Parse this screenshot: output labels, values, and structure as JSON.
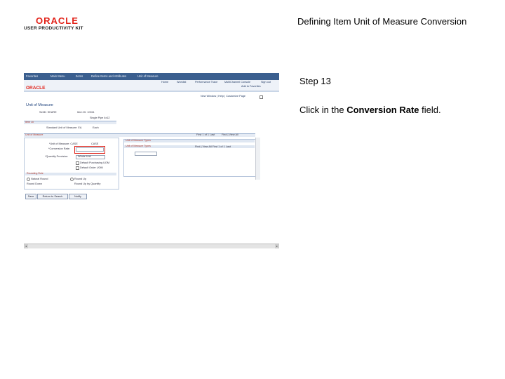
{
  "header": {
    "brand": "ORACLE",
    "product": "USER PRODUCTIVITY KIT",
    "title": "Defining Item Unit of Measure Conversion"
  },
  "step": {
    "label": "Step 13",
    "instruction_prefix": "Click in the ",
    "instruction_field": "Conversion Rate",
    "instruction_suffix": " field."
  },
  "screenshot": {
    "nav_links": [
      "Favorites",
      "Main Menu",
      "Items",
      "Define Items and Attributes",
      "Unit of Measure"
    ],
    "brand": "ORACLE",
    "menu_tabs": [
      "Home",
      "Worklist",
      "Performance Trace",
      "MultiChannel Console",
      "Add to Favorites",
      "Sign out"
    ],
    "page_links": [
      "New Window",
      "Help",
      "Customize Page"
    ],
    "page_title": "Unit of Measure",
    "fields": {
      "setid_label": "SetID: SHARE",
      "item_id_label": "Item ID: 10011",
      "item_desc": "Single Pipe 4x12",
      "item_section": "Item 10",
      "std_uom_label": "Standard Unit of Measure: EA",
      "each_label": "Each",
      "uom_section": "Unit of Measure",
      "unit_of_measure_label": "*Unit of Measure: CASE",
      "unit_of_measure_value": "CASE",
      "conversion_rate_label": "*Conversion Rate:",
      "conversion_rate_value": "",
      "quantity_precision_label": "*Quantity Precision:",
      "quantity_precision_value": "Whole Unit",
      "default_purchasing_label": "Default Purchasing UOM",
      "default_order_label": "Default Order UOM",
      "rounding_section": "Rounding Rule",
      "round_up_label": "Natural Round",
      "round_down_label": "Round Up",
      "round_note_1": "Round Down",
      "round_note_2": "Round Up by Quantity"
    },
    "pager_text": "First  1 of 1  Last",
    "find_text": "Find | View All",
    "uom_types_title": "Unit of Measure Types",
    "uom_types_header": "Unit of Measure Types",
    "uom_pager": "Find | View All   First  1 of 1  Last",
    "buttons": {
      "save": "Save",
      "return": "Return to Search",
      "notify": "Notify"
    },
    "scroll_left": "◂",
    "scroll_right": "▸"
  }
}
